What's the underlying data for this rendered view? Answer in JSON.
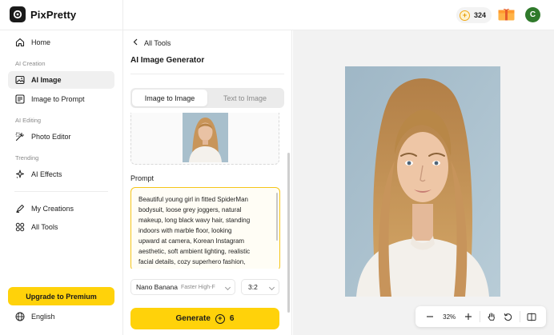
{
  "app": {
    "name": "PixPretty"
  },
  "header": {
    "credits": "324",
    "avatar_initial": "C"
  },
  "sidebar": {
    "home": "Home",
    "sections": {
      "creation": "AI Creation",
      "editing": "AI Editing",
      "trending": "Trending"
    },
    "items": {
      "ai_image": "AI Image",
      "image_to_prompt": "Image to Prompt",
      "photo_editor": "Photo Editor",
      "ai_effects": "AI Effects",
      "my_creations": "My Creations",
      "all_tools": "All Tools"
    },
    "upgrade_label": "Upgrade to Premium",
    "language": "English"
  },
  "panel": {
    "back_label": "All Tools",
    "title": "AI Image Generator",
    "tabs": {
      "image_to_image": "Image to Image",
      "text_to_image": "Text to Image",
      "selected": "image_to_image"
    },
    "prompt_label": "Prompt",
    "prompt_text": "Beautiful young girl in fitted SpiderMan\nbodysuit, loose grey joggers, natural\nmakeup, long black wavy hair, standing\nindoors with marble floor, looking\nupward at camera, Korean Instagram\naesthetic, soft ambient lighting, realistic\nfacial details, cozy superhero fashion,\nviral AI photo editing style, high",
    "model": {
      "name": "Nano Banana",
      "subtitle": "Faster High-F"
    },
    "ratio": "3:2",
    "generate": {
      "label": "Generate",
      "cost": "6"
    }
  },
  "canvas": {
    "zoom": "32%"
  },
  "colors": {
    "accent": "#ffd20a",
    "prompt_border": "#f5c518",
    "avatar": "#2f7a2b"
  },
  "icons": [
    "home-icon",
    "ai-image-icon",
    "image-to-prompt-icon",
    "photo-editor-icon",
    "ai-effects-icon",
    "my-creations-icon",
    "all-tools-icon",
    "globe-icon",
    "chevron-left-icon",
    "coin-icon",
    "gift-icon",
    "zoom-out-icon",
    "zoom-in-icon",
    "hand-icon",
    "reset-icon",
    "compare-icon"
  ]
}
